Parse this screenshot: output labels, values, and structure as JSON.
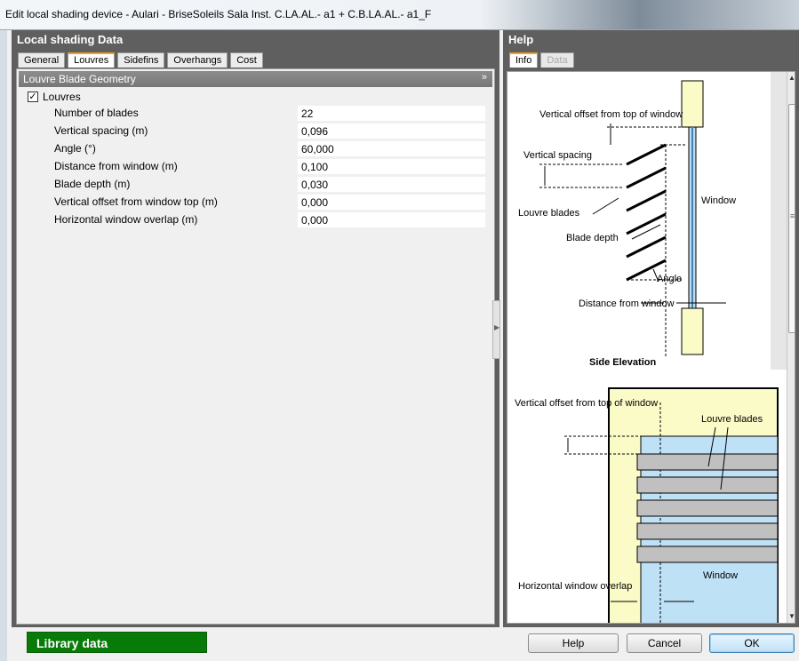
{
  "window": {
    "title": "Edit local shading device - Aulari - BriseSoleils Sala Inst. C.LA.AL.- a1 + C.B.LA.AL.- a1_F"
  },
  "left_panel": {
    "header": "Local shading Data",
    "tabs": [
      {
        "label": "General"
      },
      {
        "label": "Louvres",
        "active": true
      },
      {
        "label": "Sidefins"
      },
      {
        "label": "Overhangs"
      },
      {
        "label": "Cost"
      }
    ],
    "group": {
      "title": "Louvre Blade Geometry",
      "checkbox_label": "Louvres",
      "checked": true,
      "properties": [
        {
          "label": "Number of blades",
          "value": "22"
        },
        {
          "label": "Vertical spacing (m)",
          "value": "0,096"
        },
        {
          "label": "Angle (°)",
          "value": "60,000"
        },
        {
          "label": "Distance from window (m)",
          "value": "0,100"
        },
        {
          "label": "Blade depth (m)",
          "value": "0,030"
        },
        {
          "label": "Vertical offset from window top (m)",
          "value": "0,000"
        },
        {
          "label": "Horizontal window overlap (m)",
          "value": "0,000"
        }
      ]
    }
  },
  "right_panel": {
    "header": "Help",
    "tabs": [
      {
        "label": "Info",
        "active": true
      },
      {
        "label": "Data",
        "disabled": true
      }
    ],
    "side_diagram": {
      "label_offset": "Vertical offset from top of window",
      "label_spacing": "Vertical spacing",
      "label_window": "Window",
      "label_blades": "Louvre blades",
      "label_depth": "Blade depth",
      "label_angle": "Angle",
      "label_distance": "Distance from window",
      "caption": "Side Elevation"
    },
    "front_diagram": {
      "label_offset": "Vertical offset from top of window",
      "label_blades": "Louvre blades",
      "label_window": "Window",
      "label_overlap": "Horizontal window overlap"
    }
  },
  "footer": {
    "library_label": "Library data",
    "help_button": "Help",
    "cancel_button": "Cancel",
    "ok_button": "OK"
  },
  "colors": {
    "panel_frame": "#5f5f5f",
    "library": "#087a08",
    "active_tab_accent": "#f0a020"
  }
}
